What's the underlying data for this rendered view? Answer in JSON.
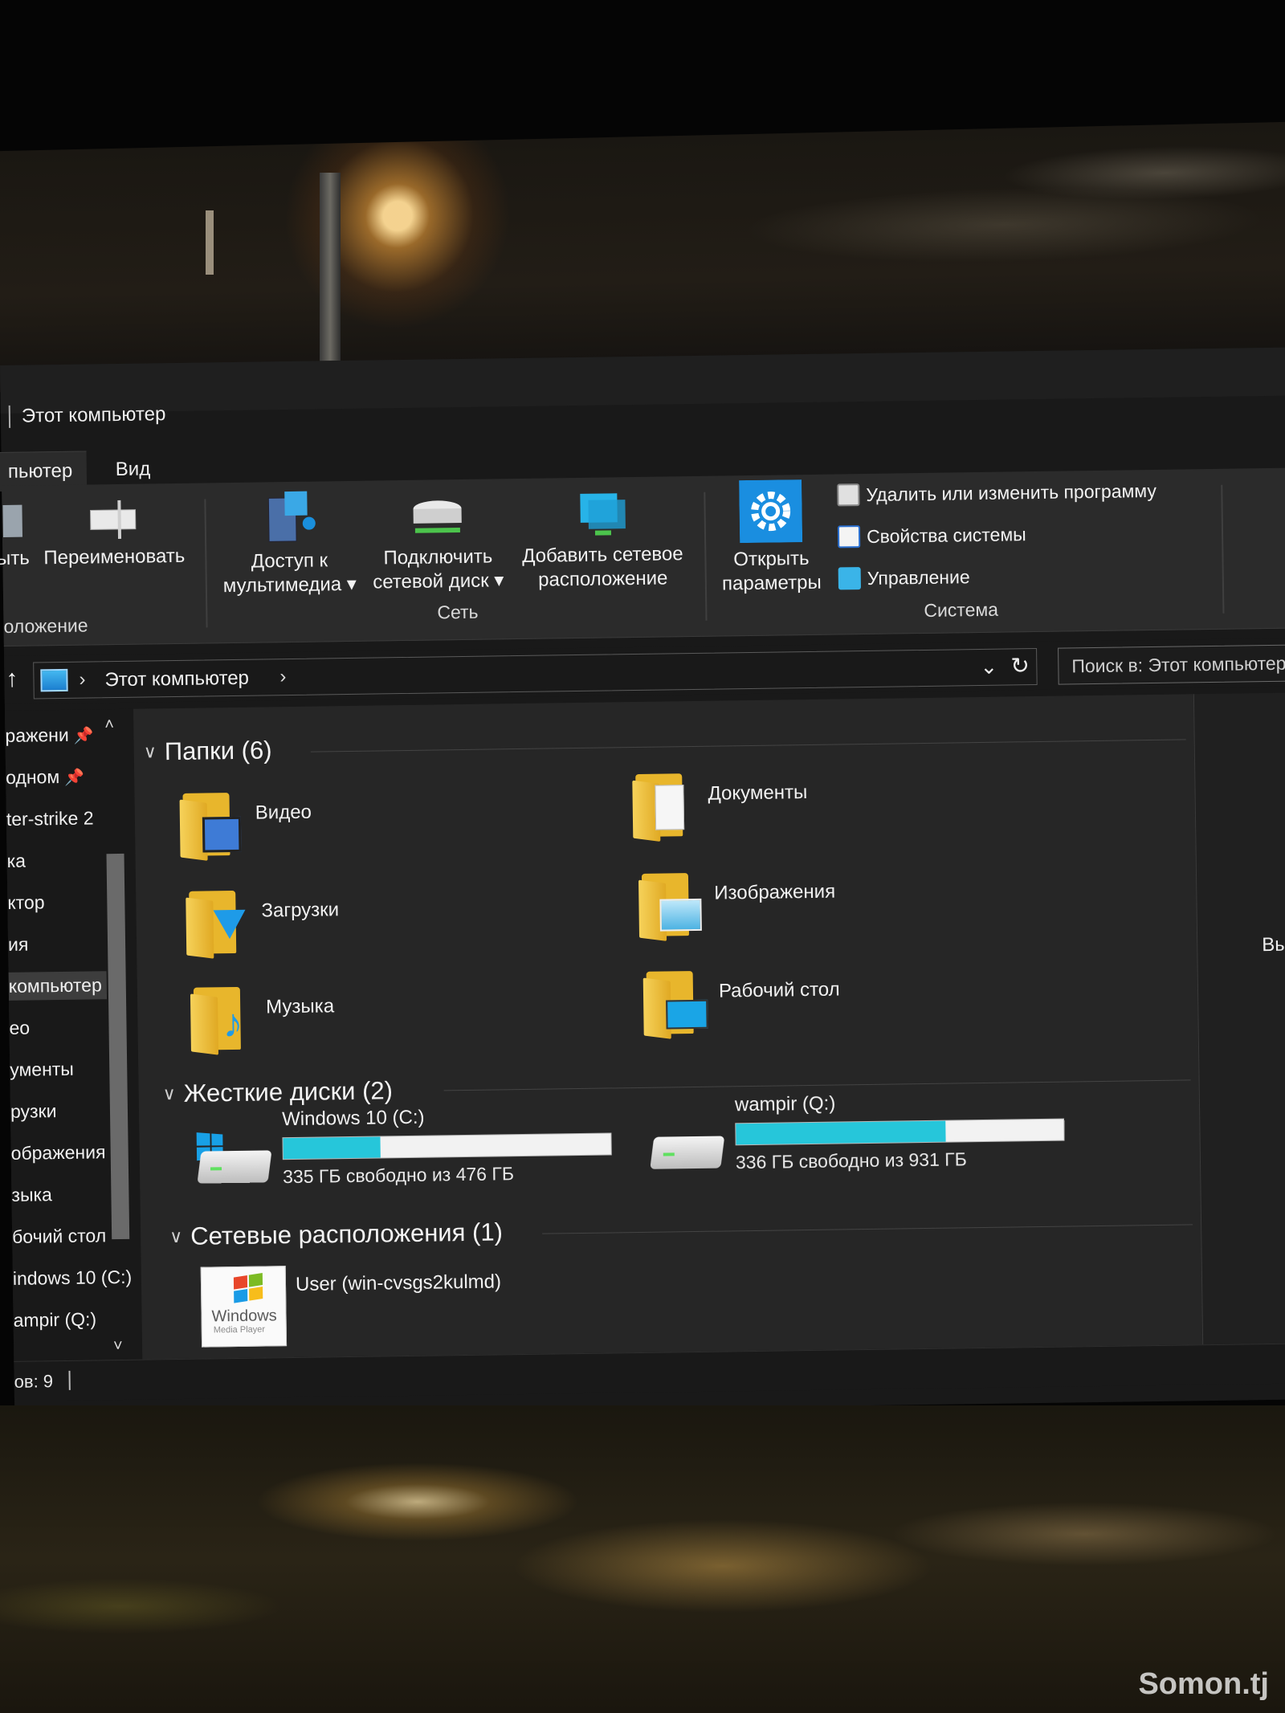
{
  "window": {
    "title": "Этот компьютер"
  },
  "tabs": {
    "computer": "пьютер",
    "view": "Вид"
  },
  "ribbon": {
    "location_group": {
      "left_button": "ыть",
      "rename": "Переименовать",
      "label": "оложение"
    },
    "network_group": {
      "media_access": [
        "Доступ к",
        "мультимедиа ▾"
      ],
      "map_drive": [
        "Подключить",
        "сетевой диск ▾"
      ],
      "add_location": [
        "Добавить сетевое",
        "расположение"
      ],
      "label": "Сеть"
    },
    "system_group": {
      "open_settings": [
        "Открыть",
        "параметры"
      ],
      "uninstall": "Удалить или изменить программу",
      "system_properties": "Свойства системы",
      "manage": "Управление",
      "label": "Система"
    }
  },
  "address": {
    "path": "Этот компьютер",
    "search_placeholder": "Поиск в: Этот компьютер"
  },
  "nav": {
    "items": [
      "ражени",
      "одном",
      "ter-strike 2",
      "ка",
      "ктор",
      "ия",
      "компьютер",
      "ео",
      "ументы",
      "рузки",
      "ображения",
      "зыка",
      "бочий стол",
      "indows 10 (C:)",
      "ampir (Q:)"
    ],
    "selected_index": 6
  },
  "folders": {
    "header": "Папки (6)",
    "items": [
      "Видео",
      "Документы",
      "Загрузки",
      "Изображения",
      "Музыка",
      "Рабочий стол"
    ]
  },
  "drives": {
    "header": "Жесткие диски (2)",
    "items": [
      {
        "name": "Windows 10 (C:)",
        "free": "335 ГБ свободно из 476 ГБ",
        "used_fraction": 0.296
      },
      {
        "name": "wampir (Q:)",
        "free": "336 ГБ свободно из 931 ГБ",
        "used_fraction": 0.639
      }
    ]
  },
  "network": {
    "header": "Сетевые расположения (1)",
    "items": [
      {
        "name": "User (win-cvsgs2kulmd)",
        "icon_text": "Windows",
        "icon_sub": "Media Player"
      }
    ]
  },
  "right_pane": {
    "text": "Вы"
  },
  "status": {
    "text": "ов: 9"
  },
  "watermark": "Somon.tj",
  "colors": {
    "accent": "#26c6da",
    "folder": "#e8b62c",
    "background": "#262626"
  }
}
